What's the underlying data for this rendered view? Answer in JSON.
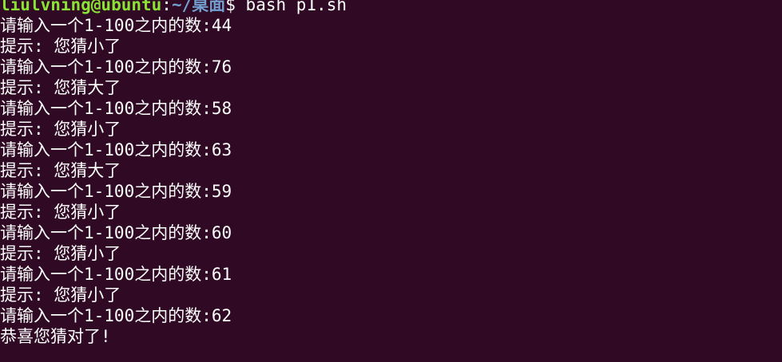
{
  "prompt": {
    "user_host": "liulvning@ubuntu",
    "separator": ":",
    "cwd": "~/桌面",
    "symbol": "$",
    "command": " bash p1.sh"
  },
  "output": [
    "请输入一个1-100之内的数:44",
    "提示: 您猜小了",
    "请输入一个1-100之内的数:76",
    "提示: 您猜大了",
    "请输入一个1-100之内的数:58",
    "提示: 您猜小了",
    "请输入一个1-100之内的数:63",
    "提示: 您猜大了",
    "请输入一个1-100之内的数:59",
    "提示: 您猜小了",
    "请输入一个1-100之内的数:60",
    "提示: 您猜小了",
    "请输入一个1-100之内的数:61",
    "提示: 您猜小了",
    "请输入一个1-100之内的数:62",
    "恭喜您猜对了!"
  ],
  "colors": {
    "background": "#300a24",
    "text": "#ffffff",
    "prompt_user": "#8ae234",
    "prompt_path": "#729fcf"
  }
}
